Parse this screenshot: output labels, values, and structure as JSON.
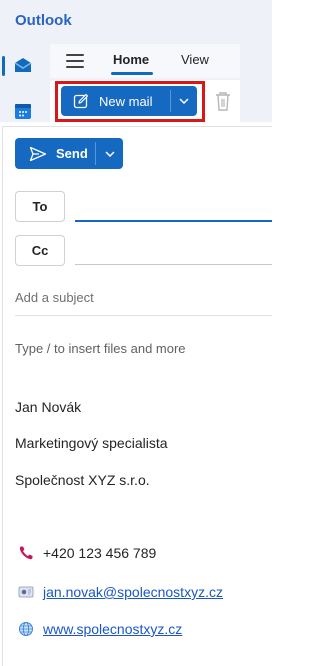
{
  "app": {
    "title": "Outlook"
  },
  "ribbon": {
    "tabs": [
      {
        "label": "Home",
        "selected": true
      },
      {
        "label": "View",
        "selected": false
      }
    ],
    "new_mail_label": "New mail"
  },
  "compose": {
    "send_label": "Send",
    "to_label": "To",
    "cc_label": "Cc",
    "to_value": "",
    "cc_value": "",
    "subject_placeholder": "Add a subject",
    "body_hint": "Type / to insert files and more"
  },
  "signature": {
    "name": "Jan Novák",
    "role": "Marketingový specialista",
    "company": "Společnost XYZ s.r.o.",
    "phone": "+420 123 456 789",
    "email": "jan.novak@spolecnostxyz.cz",
    "website": "www.spolecnostxyz.cz"
  },
  "colors": {
    "accent": "#1669c1",
    "highlight_box": "#d71818",
    "phone_icon": "#c2185b"
  },
  "icons": {
    "mail_rail": "envelope-icon",
    "calendar_rail": "calendar-icon",
    "menu": "hamburger-icon",
    "new_mail": "compose-icon",
    "dropdown": "chevron-down-icon",
    "delete": "trash-icon",
    "send": "send-icon",
    "phone": "phone-icon",
    "email": "email-icon",
    "web": "globe-icon"
  }
}
